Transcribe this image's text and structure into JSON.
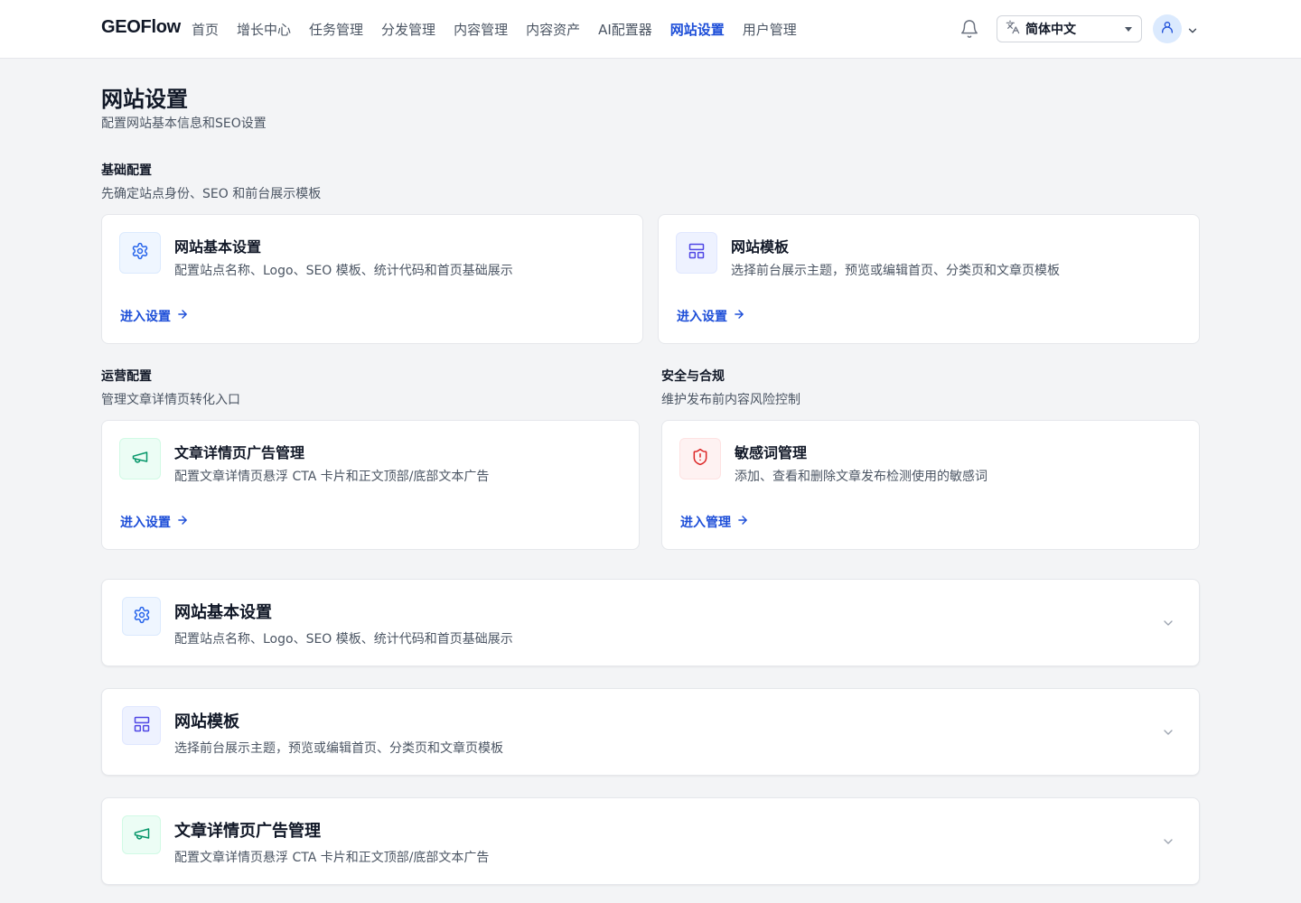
{
  "header": {
    "brand": "GEOFlow",
    "nav": [
      "首页",
      "增长中心",
      "任务管理",
      "分发管理",
      "内容管理",
      "内容资产",
      "AI配置器",
      "网站设置",
      "用户管理"
    ],
    "active_nav": "网站设置",
    "language": "简体中文",
    "icons": {
      "notifications": "bell-icon",
      "language": "translate-icon",
      "user": "user-icon",
      "menu": "chevron-down-icon"
    }
  },
  "page": {
    "title": "网站设置",
    "subtitle": "配置网站基本信息和SEO设置"
  },
  "sections": {
    "basic": {
      "title": "基础配置",
      "subtitle": "先确定站点身份、SEO 和前台展示模板",
      "cards": [
        {
          "title": "网站基本设置",
          "desc": "配置站点名称、Logo、SEO 模板、统计代码和首页基础展示",
          "link": "进入设置",
          "icon": "gear-icon"
        },
        {
          "title": "网站模板",
          "desc": "选择前台展示主题，预览或编辑首页、分类页和文章页模板",
          "link": "进入设置",
          "icon": "layout-icon"
        }
      ]
    },
    "operations": {
      "title": "运营配置",
      "subtitle": "管理文章详情页转化入口",
      "card": {
        "title": "文章详情页广告管理",
        "desc": "配置文章详情页悬浮 CTA 卡片和正文顶部/底部文本广告",
        "link": "进入设置",
        "icon": "megaphone-icon"
      }
    },
    "security": {
      "title": "安全与合规",
      "subtitle": "维护发布前内容风险控制",
      "card": {
        "title": "敏感词管理",
        "desc": "添加、查看和删除文章发布检测使用的敏感词",
        "link": "进入管理",
        "icon": "shield-alert-icon"
      }
    }
  },
  "accordions": [
    {
      "title": "网站基本设置",
      "desc": "配置站点名称、Logo、SEO 模板、统计代码和首页基础展示",
      "icon": "gear-icon"
    },
    {
      "title": "网站模板",
      "desc": "选择前台展示主题，预览或编辑首页、分类页和文章页模板",
      "icon": "layout-icon"
    },
    {
      "title": "文章详情页广告管理",
      "desc": "配置文章详情页悬浮 CTA 卡片和正文顶部/底部文本广告",
      "icon": "megaphone-icon"
    }
  ],
  "colors": {
    "accent": "#1d4ed8",
    "background": "#f3f4f6",
    "green": "#059669",
    "red": "#dc2626"
  }
}
